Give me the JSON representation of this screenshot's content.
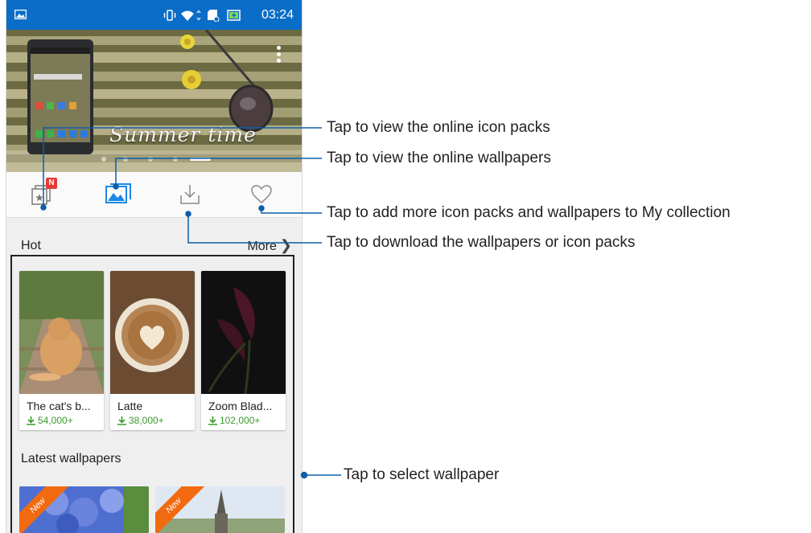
{
  "status_bar": {
    "time": "03:24"
  },
  "banner": {
    "title": "Summer time"
  },
  "tabs": [
    {
      "name": "icon-packs",
      "badge": "N"
    },
    {
      "name": "wallpapers"
    },
    {
      "name": "downloads"
    },
    {
      "name": "my-collection"
    }
  ],
  "hot": {
    "title": "Hot",
    "more_label": "More",
    "items": [
      {
        "name": "The cat's b...",
        "downloads": "54,000+"
      },
      {
        "name": "Latte",
        "downloads": "38,000+"
      },
      {
        "name": "Zoom Blad...",
        "downloads": "102,000+"
      }
    ]
  },
  "latest": {
    "title": "Latest wallpapers",
    "items": [
      {
        "badge": "New"
      },
      {
        "badge": "New"
      }
    ]
  },
  "callouts": {
    "icon_packs": "Tap to view the online icon packs",
    "wallpapers": "Tap to view the online wallpapers",
    "collection": "Tap to add more icon packs and wallpapers to My collection",
    "download": "Tap to download the wallpapers or icon packs",
    "select": "Tap to select wallpaper"
  },
  "colors": {
    "status_bar": "#0a6dc7",
    "accent": "#1e88e5",
    "download_green": "#3a9a2a",
    "new_badge": "#f26a10",
    "callout_line": "#0b5ea8"
  }
}
